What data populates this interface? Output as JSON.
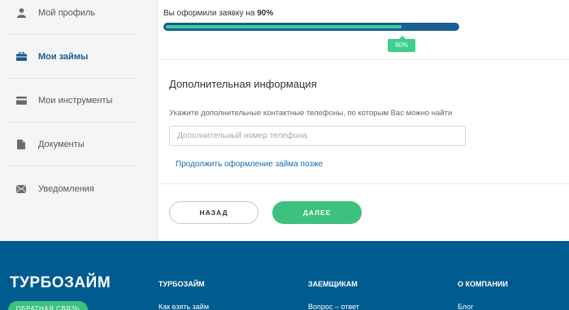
{
  "sidebar": {
    "items": [
      {
        "label": "Мой профиль",
        "icon": "user-icon",
        "active": false
      },
      {
        "label": "Мои займы",
        "icon": "briefcase-icon",
        "active": true
      },
      {
        "label": "Мои инструменты",
        "icon": "card-icon",
        "active": false
      },
      {
        "label": "Документы",
        "icon": "document-icon",
        "active": false
      },
      {
        "label": "Уведомления",
        "icon": "envelope-icon",
        "active": false
      }
    ]
  },
  "progress": {
    "prefix": "Вы оформили заявку на",
    "percent_text": "90%",
    "percent": 90,
    "badge": "90%"
  },
  "additional": {
    "title": "Дополнительная информация",
    "hint": "Укажите дополнительные контактные телефоны, по которым Вас можно найти",
    "phone_placeholder": "Дополнительный номер телефона",
    "later_link": "Продолжить оформление займа позже"
  },
  "buttons": {
    "back": "НАЗАД",
    "next": "ДАЛЕЕ"
  },
  "footer": {
    "logo": "ТУРБОЗАЙМ",
    "feedback": "ОБРАТНАЯ СВЯЗЬ",
    "columns": [
      {
        "title": "ТУРБОЗАЙМ",
        "link": "Как взять займ"
      },
      {
        "title": "ЗАЕМЩИКАМ",
        "link": "Вопрос – ответ"
      },
      {
        "title": "О КОМПАНИИ",
        "link": "Блог"
      }
    ]
  },
  "colors": {
    "accent_green": "#3cc17f",
    "brand_blue": "#005b8f",
    "link_blue": "#1a6aa8"
  }
}
